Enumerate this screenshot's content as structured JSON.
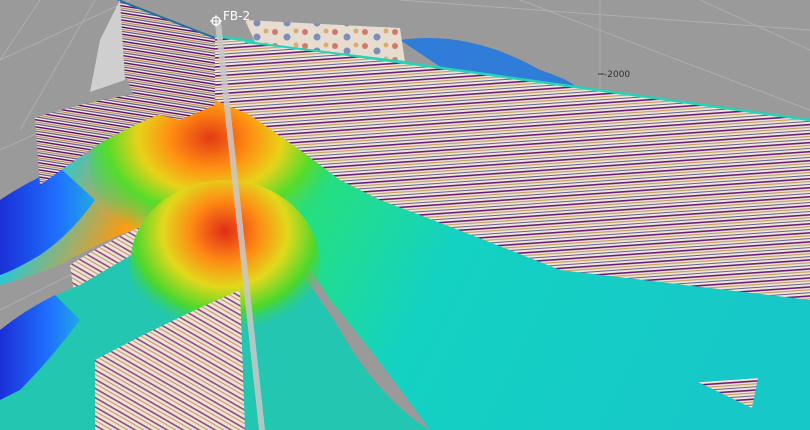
{
  "viewport": {
    "background_color": "#9a9a9a",
    "grid_color": "#b4b4b4"
  },
  "well": {
    "name": "FB-2",
    "marker_icon": "well-marker-icon",
    "label_color": "#ffffff"
  },
  "depth_axis": {
    "tick_label": "-2000"
  },
  "horizon_colormap": [
    "#1a2fd6",
    "#1f8bff",
    "#13d2d2",
    "#27e07c",
    "#5fe02a",
    "#d6e21b",
    "#ff9a12",
    "#ee3a14"
  ],
  "seismic_colors": {
    "peak": "#5a0a6e",
    "trough": "#2e2a7a",
    "neutral": "#efe8dc",
    "warm": "#b8863e",
    "top_reflector": "#27d3b8"
  }
}
